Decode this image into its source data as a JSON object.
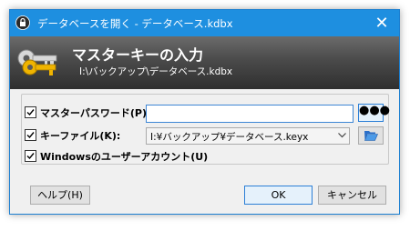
{
  "window": {
    "title": "データベースを開く - データベース.kdbx",
    "close_glyph": "✕"
  },
  "banner": {
    "title": "マスターキーの入力",
    "subtitle": "I:\\バックアップ\\データベース.kdbx"
  },
  "fields": {
    "master_password": {
      "label": "マスターパスワード(P):",
      "checked": true,
      "value": ""
    },
    "key_file": {
      "label": "キーファイル(K):",
      "checked": true,
      "value": "I:¥バックアップ¥データベース.keyx"
    },
    "windows_account": {
      "label": "Windowsのユーザーアカウント(U)",
      "checked": true
    }
  },
  "buttons": {
    "reveal_password": "●●●",
    "help": "ヘルプ(H)",
    "ok": "OK",
    "cancel": "キャンセル"
  },
  "icons": {
    "title": "lock-icon",
    "banner": "keys-icon",
    "browse": "folder-open-icon",
    "dropdown": "chevron-down-icon"
  },
  "colors": {
    "titlebar": "#1e8fe0",
    "accent_border": "#2c7fd6"
  }
}
